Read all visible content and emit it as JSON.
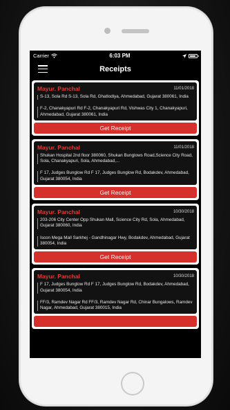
{
  "status": {
    "carrier": "Carrier",
    "time": "6:03 PM"
  },
  "nav": {
    "title": "Receipts"
  },
  "receipts": [
    {
      "name": "Mayur. Panchal",
      "date": "11/01/2018",
      "pickup": "S-13, Sola Rd S-13, Sola Rd, Ghatlodiya, Ahmedabad, Gujarat 380061, India",
      "drop": "F-2, Chanakyapuri Rd F-2, Chanakyapuri Rd, Vishwas City 1, Chanakyapuri, Ahmedabad, Gujarat 380061, India",
      "button": "Get Receipt"
    },
    {
      "name": "Mayur. Panchal",
      "date": "11/01/2018",
      "pickup": "Shukan Hospital 2nd floor 380060, Shukan Bunglows Road,Science City Road, Sola, Chanakyapuri, Sola, Ahmedabad,...",
      "drop": "F 17, Judges Bunglow Rd F 17, Judges Bunglow Rd, Bodakdev, Ahmedabad, Gujarat 380054, India",
      "button": "Get Receipt"
    },
    {
      "name": "Mayur. Panchal",
      "date": "10/30/2018",
      "pickup": "203-206 City Center Opp Shukan Mall, Science City Rd, Sola, Ahmedabad, Gujarat 380060, India",
      "drop": "Iscon Mega Mall Sarkhej - Gandhinagar Hwy, Bodakdev, Ahmedabad, Gujarat 380054, India",
      "button": "Get Receipt"
    },
    {
      "name": "Mayur. Panchal",
      "date": "10/30/2018",
      "pickup": "F 17, Judges Bunglow Rd F 17, Judges Bunglow Rd, Bodakdev, Ahmedabad, Gujarat 380054, India",
      "drop": "FF/3, Ramdev Nagar Rd FF/3, Ramdev Nagar Rd, Chinar Bungalows, Ramdev Nagar, Ahmedabad, Gujarat 380015, India",
      "button": ""
    }
  ]
}
